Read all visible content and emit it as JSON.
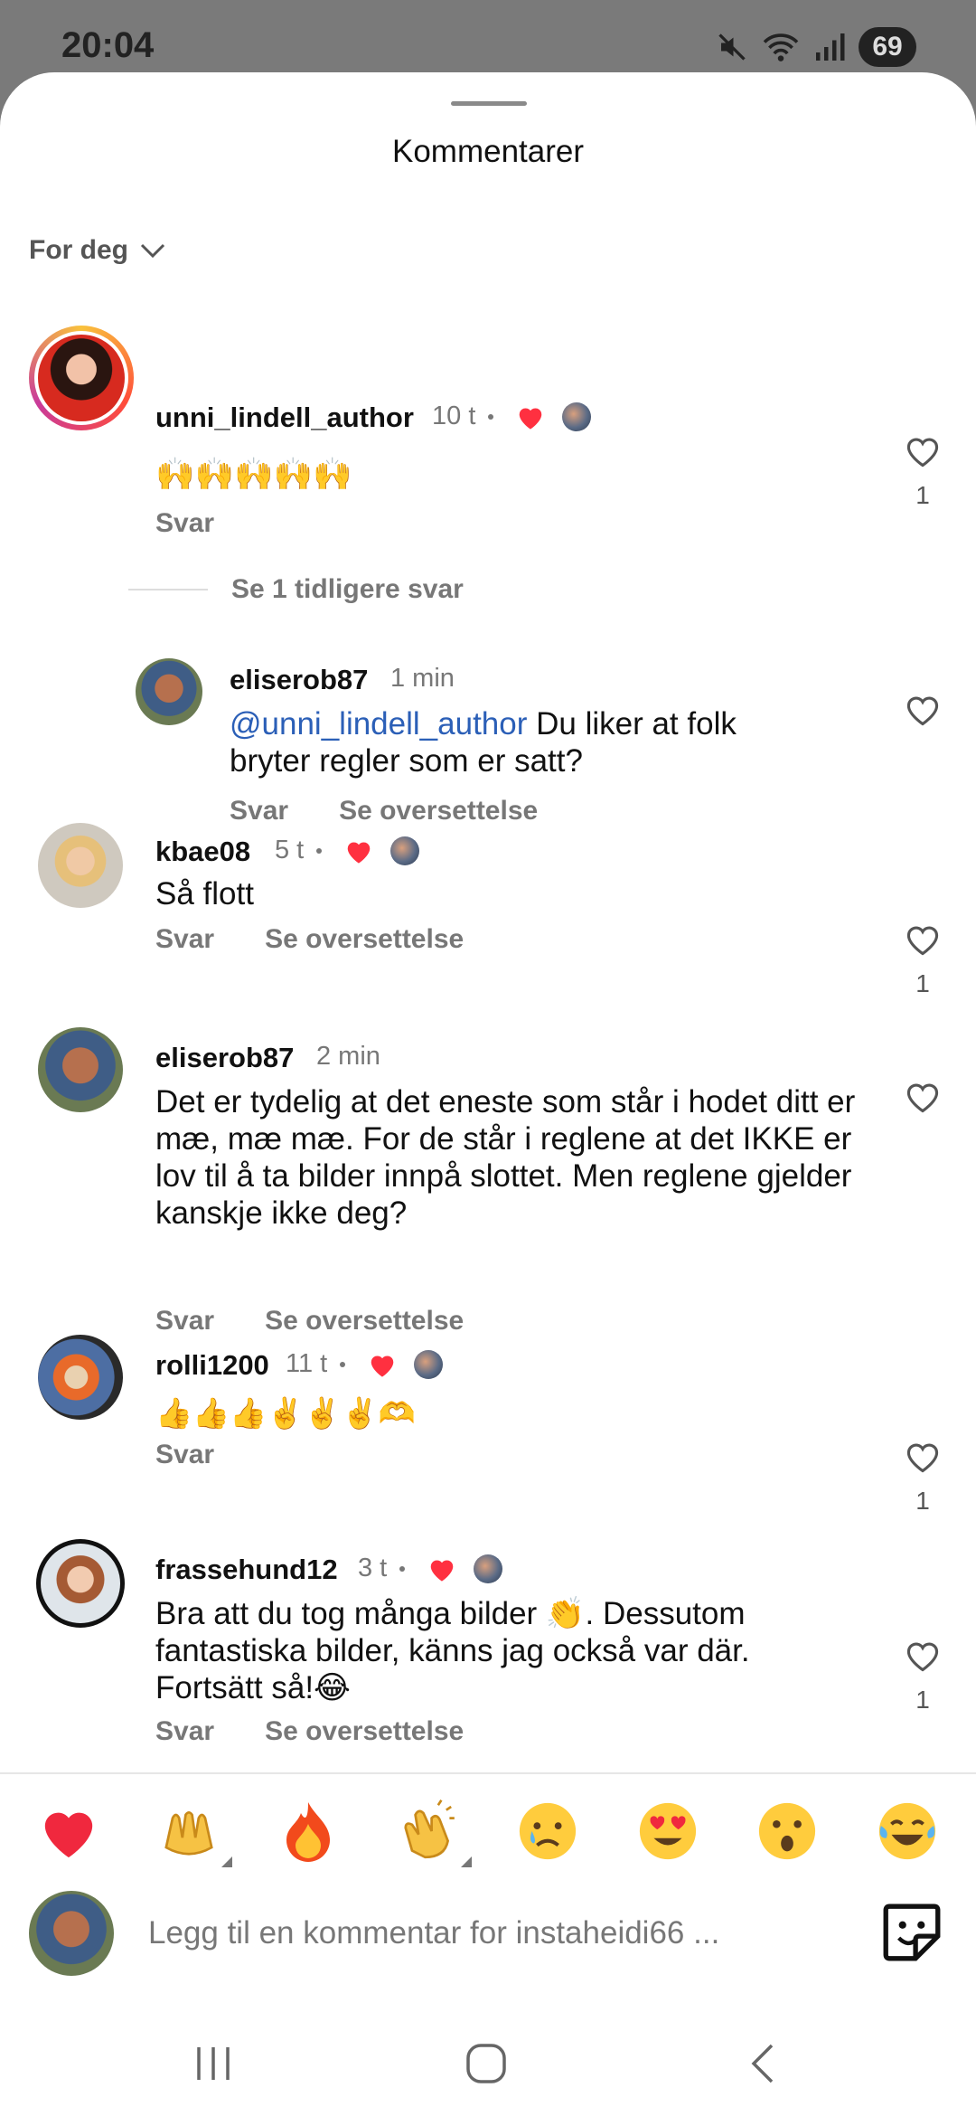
{
  "status_bar": {
    "time": "20:04",
    "battery": "69"
  },
  "sheet": {
    "title": "Kommentarer",
    "filter_label": "For deg"
  },
  "comments": [
    {
      "username": "unni_lindell_author",
      "time": "10 t",
      "text": "🙌🙌🙌🙌🙌",
      "reply_label": "Svar",
      "likes": "1"
    },
    {
      "username": "eliserob87",
      "time": "1 min",
      "mention": "@unni_lindell_author",
      "text": " Du liker at folk bryter regler som er satt?",
      "reply_label": "Svar",
      "translate_label": "Se oversettelse"
    },
    {
      "username": "kbae08",
      "time": "5 t",
      "text": "Så flott",
      "reply_label": "Svar",
      "translate_label": "Se oversettelse",
      "likes": "1"
    },
    {
      "username": "eliserob87",
      "time": "2 min",
      "text": "Det er tydelig at det eneste som står i hodet ditt er mæ, mæ mæ. For de står i reglene at det IKKE er lov til å ta bilder innpå slottet. Men reglene gjelder kanskje ikke deg?",
      "reply_label": "Svar",
      "translate_label": "Se oversettelse"
    },
    {
      "username": "rolli1200",
      "time": "11 t",
      "text": "👍👍👍✌️✌️✌️🫶",
      "reply_label": "Svar",
      "likes": "1"
    },
    {
      "username": "frassehund12",
      "time": "3 t",
      "text": "Bra att du tog många bilder 👏. Dessutom fantastiska bilder, känns jag också var där. Fortsätt så!😂",
      "reply_label": "Svar",
      "translate_label": "Se oversettelse",
      "likes": "1"
    }
  ],
  "more_replies_label": "Se 1 tidligere svar",
  "emoji_bar": [
    "heart",
    "raised-hands",
    "fire",
    "clapping-hands",
    "crying-face",
    "heart-eyes",
    "surprised-face",
    "tears-of-joy"
  ],
  "input": {
    "placeholder": "Legg til en kommentar for instaheidi66 ..."
  },
  "colors": {
    "accent_red": "#ff3040",
    "mention_blue": "#2b5fb7",
    "muted": "#777777"
  }
}
